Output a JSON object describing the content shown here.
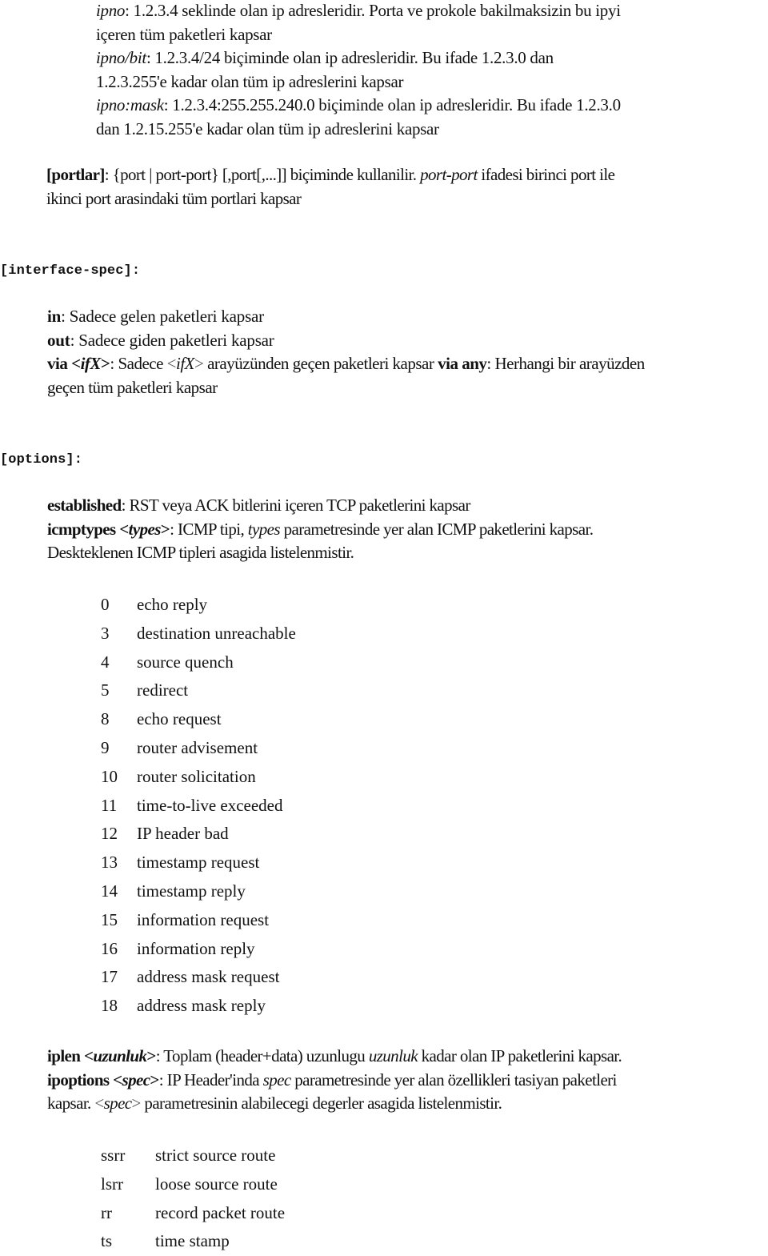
{
  "ip_definitions": [
    {
      "term": "ipno",
      "lines": [
        ": 1.2.3.4 seklinde olan ip adresleridir. Porta ve prokole bakilmaksizin bu ipyi",
        "içeren tüm paketleri kapsar"
      ]
    },
    {
      "term": "ipno/bit",
      "lines": [
        ": 1.2.3.4/24 biçiminde olan ip adresleridir. Bu ifade 1.2.3.0 dan",
        "1.2.3.255'e kadar olan tüm ip adreslerini kapsar"
      ]
    },
    {
      "term": "ipno:mask",
      "lines": [
        ": 1.2.3.4:255.255.240.0 biçiminde olan ip adresleridir. Bu ifade 1.2.3.0",
        "dan 1.2.15.255'e kadar olan tüm ip adreslerini kapsar"
      ]
    }
  ],
  "portlar": {
    "term": "[portlar]",
    "syntax": ": {port | port-port} [,port[,...]] biçiminde kullanilir. ",
    "em": "port-port",
    "rest": " ifadesi birinci port ile",
    "line2": "ikinci port arasindaki tüm portlari kapsar"
  },
  "interface_spec": {
    "heading": "[interface-spec]:",
    "items": {
      "in": {
        "term": "in",
        "text": ": Sadece gelen paketleri kapsar"
      },
      "out": {
        "term": "out",
        "text": ": Sadece giden paketleri kapsar"
      },
      "via": {
        "term": "via <",
        "term_em": "ifX",
        "term_end": ">",
        "text1": ": Sadece ",
        "inline_lt": "<",
        "inline_em": "ifX",
        "inline_gt": ">",
        "text2": " arayüzünden geçen paketleri kapsar ",
        "term2": "via any",
        "text3": ": Herhangi bir arayüzden",
        "line2": "geçen tüm paketleri kapsar"
      }
    }
  },
  "options": {
    "heading": "[options]:",
    "established": {
      "term": "established",
      "text": ": RST veya ACK bitlerini içeren TCP paketlerini kapsar"
    },
    "icmptypes": {
      "term": "icmptypes <",
      "term_em": "types",
      "term_end": ">",
      "text1": ": ICMP tipi, ",
      "em": "types",
      "text2": " parametresinde yer alan ICMP paketlerini kapsar.",
      "line2": "Deskteklenen ICMP tipleri asagida listelenmistir."
    },
    "icmp_types_list": [
      {
        "code": "0",
        "name": "echo reply"
      },
      {
        "code": "3",
        "name": "destination unreachable"
      },
      {
        "code": "4",
        "name": "source quench"
      },
      {
        "code": "5",
        "name": "redirect"
      },
      {
        "code": "8",
        "name": "echo request"
      },
      {
        "code": "9",
        "name": "router advisement"
      },
      {
        "code": "10",
        "name": "router solicitation"
      },
      {
        "code": "11",
        "name": "time-to-live exceeded"
      },
      {
        "code": "12",
        "name": "IP header bad"
      },
      {
        "code": "13",
        "name": "timestamp request"
      },
      {
        "code": "14",
        "name": "timestamp reply"
      },
      {
        "code": "15",
        "name": "information request"
      },
      {
        "code": "16",
        "name": "information reply"
      },
      {
        "code": "17",
        "name": "address mask request"
      },
      {
        "code": "18",
        "name": "address mask reply"
      }
    ],
    "iplen": {
      "term": "iplen <",
      "term_em": "uzunluk",
      "term_end": ">",
      "text1": ": Toplam (header+data) uzunlugu ",
      "em": "uzunluk",
      "text2": " kadar olan IP paketlerini kapsar."
    },
    "ipoptions": {
      "term": "ipoptions <",
      "term_em": "spec",
      "term_end": ">",
      "text1": ": IP Header'inda ",
      "em": "spec",
      "text2": " parametresinde yer alan özellikleri tasiyan paketleri",
      "line2_a": "kapsar. ",
      "inline_lt": "<",
      "inline_em": "spec",
      "inline_gt": ">",
      "line2_b": " parametresinin alabilecegi degerler asagida listelenmistir."
    },
    "spec_list": [
      {
        "code": "ssrr",
        "name": "strict source route"
      },
      {
        "code": "lsrr",
        "name": "loose source route"
      },
      {
        "code": "rr",
        "name": "record packet route"
      },
      {
        "code": "ts",
        "name": "time stamp"
      }
    ]
  }
}
